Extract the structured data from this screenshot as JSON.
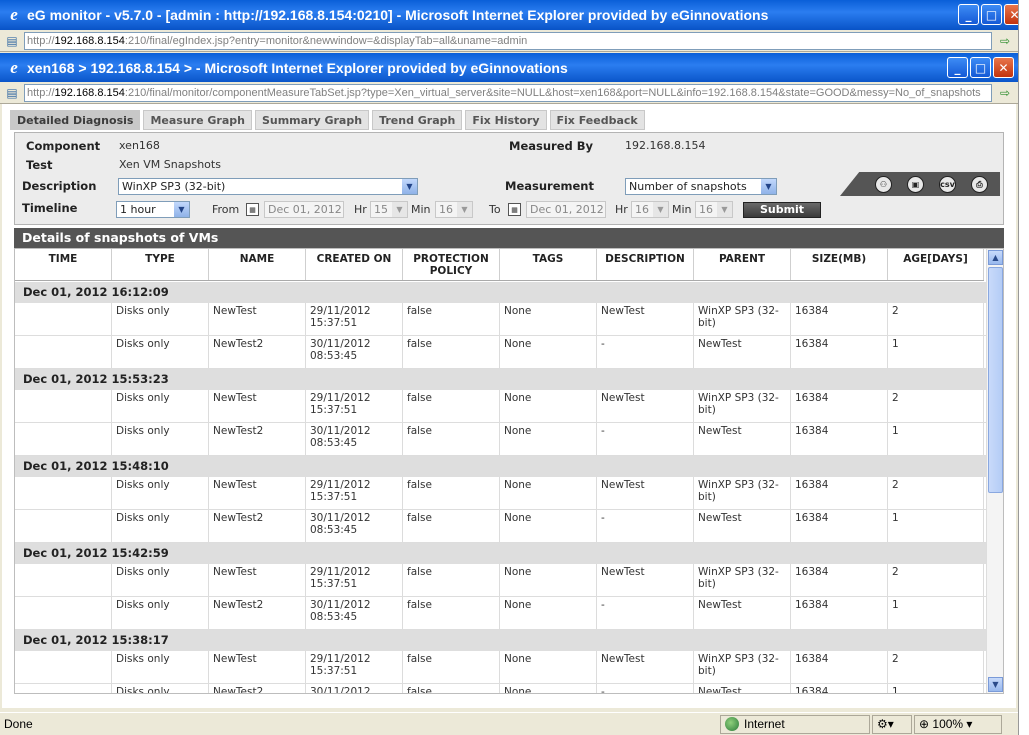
{
  "outer_window": {
    "title": "eG monitor - v5.7.0 - [admin : http://192.168.8.154:0210] - Microsoft Internet Explorer provided by eGinnovations",
    "url_prefix": "http://",
    "url_host": "192.168.8.154",
    "url_rest": ":210/final/egIndex.jsp?entry=monitor&newwindow=&displayTab=all&uname=admin"
  },
  "inner_window": {
    "title": "xen168 > 192.168.8.154 > - Microsoft Internet Explorer provided by eGinnovations",
    "url_prefix": "http://",
    "url_host": "192.168.8.154",
    "url_rest": ":210/final/monitor/componentMeasureTabSet.jsp?type=Xen_virtual_server&site=NULL&host=xen168&port=NULL&info=192.168.8.154&state=GOOD&messy=No_of_snapshots"
  },
  "tabs": [
    "Detailed Diagnosis",
    "Measure Graph",
    "Summary Graph",
    "Trend Graph",
    "Fix History",
    "Fix Feedback"
  ],
  "info": {
    "component_label": "Component",
    "component_value": "xen168",
    "test_label": "Test",
    "test_value": "Xen VM Snapshots",
    "measured_by_label": "Measured By",
    "measured_by_value": "192.168.8.154",
    "description_label": "Description",
    "description_value": "WinXP SP3 (32-bit)",
    "measurement_label": "Measurement",
    "measurement_value": "Number of snapshots",
    "timeline_label": "Timeline",
    "timeline_value": "1 hour",
    "from_label": "From",
    "from_date": "Dec 01, 2012",
    "from_hr_label": "Hr",
    "from_hr": "15",
    "from_min_label": "Min",
    "from_min": "16",
    "to_label": "To",
    "to_date": "Dec 01, 2012",
    "to_hr_label": "Hr",
    "to_hr": "16",
    "to_min_label": "Min",
    "to_min": "16",
    "submit_label": "Submit"
  },
  "toolbar_icons": {
    "binoculars": "⚇",
    "document": "▣",
    "csv": "csv",
    "print": "⎙"
  },
  "details_title": "Details of snapshots of VMs",
  "columns": [
    "TIME",
    "TYPE",
    "NAME",
    "CREATED ON",
    "PROTECTION POLICY",
    "TAGS",
    "DESCRIPTION",
    "PARENT",
    "SIZE(MB)",
    "AGE[DAYS]"
  ],
  "groups": [
    {
      "time": "Dec 01, 2012 16:12:09",
      "rows": [
        {
          "type": "Disks only",
          "name": "NewTest",
          "created": "29/11/2012 15:37:51",
          "policy": "false",
          "tags": "None",
          "description": "NewTest",
          "parent": "WinXP SP3 (32-bit)",
          "size": "16384",
          "age": "2"
        },
        {
          "type": "Disks only",
          "name": "NewTest2",
          "created": "30/11/2012 08:53:45",
          "policy": "false",
          "tags": "None",
          "description": "-",
          "parent": "NewTest",
          "size": "16384",
          "age": "1"
        }
      ]
    },
    {
      "time": "Dec 01, 2012 15:53:23",
      "rows": [
        {
          "type": "Disks only",
          "name": "NewTest",
          "created": "29/11/2012 15:37:51",
          "policy": "false",
          "tags": "None",
          "description": "NewTest",
          "parent": "WinXP SP3 (32-bit)",
          "size": "16384",
          "age": "2"
        },
        {
          "type": "Disks only",
          "name": "NewTest2",
          "created": "30/11/2012 08:53:45",
          "policy": "false",
          "tags": "None",
          "description": "-",
          "parent": "NewTest",
          "size": "16384",
          "age": "1"
        }
      ]
    },
    {
      "time": "Dec 01, 2012 15:48:10",
      "rows": [
        {
          "type": "Disks only",
          "name": "NewTest",
          "created": "29/11/2012 15:37:51",
          "policy": "false",
          "tags": "None",
          "description": "NewTest",
          "parent": "WinXP SP3 (32-bit)",
          "size": "16384",
          "age": "2"
        },
        {
          "type": "Disks only",
          "name": "NewTest2",
          "created": "30/11/2012 08:53:45",
          "policy": "false",
          "tags": "None",
          "description": "-",
          "parent": "NewTest",
          "size": "16384",
          "age": "1"
        }
      ]
    },
    {
      "time": "Dec 01, 2012 15:42:59",
      "rows": [
        {
          "type": "Disks only",
          "name": "NewTest",
          "created": "29/11/2012 15:37:51",
          "policy": "false",
          "tags": "None",
          "description": "NewTest",
          "parent": "WinXP SP3 (32-bit)",
          "size": "16384",
          "age": "2"
        },
        {
          "type": "Disks only",
          "name": "NewTest2",
          "created": "30/11/2012 08:53:45",
          "policy": "false",
          "tags": "None",
          "description": "-",
          "parent": "NewTest",
          "size": "16384",
          "age": "1"
        }
      ]
    },
    {
      "time": "Dec 01, 2012 15:38:17",
      "rows": [
        {
          "type": "Disks only",
          "name": "NewTest",
          "created": "29/11/2012 15:37:51",
          "policy": "false",
          "tags": "None",
          "description": "NewTest",
          "parent": "WinXP SP3 (32-bit)",
          "size": "16384",
          "age": "2"
        },
        {
          "type": "Disks only",
          "name": "NewTest2",
          "created": "30/11/2012",
          "policy": "false",
          "tags": "None",
          "description": "-",
          "parent": "NewTest",
          "size": "16384",
          "age": "1"
        }
      ]
    }
  ],
  "status": {
    "text": "Done",
    "zone": "Internet",
    "zoom": "100%"
  }
}
